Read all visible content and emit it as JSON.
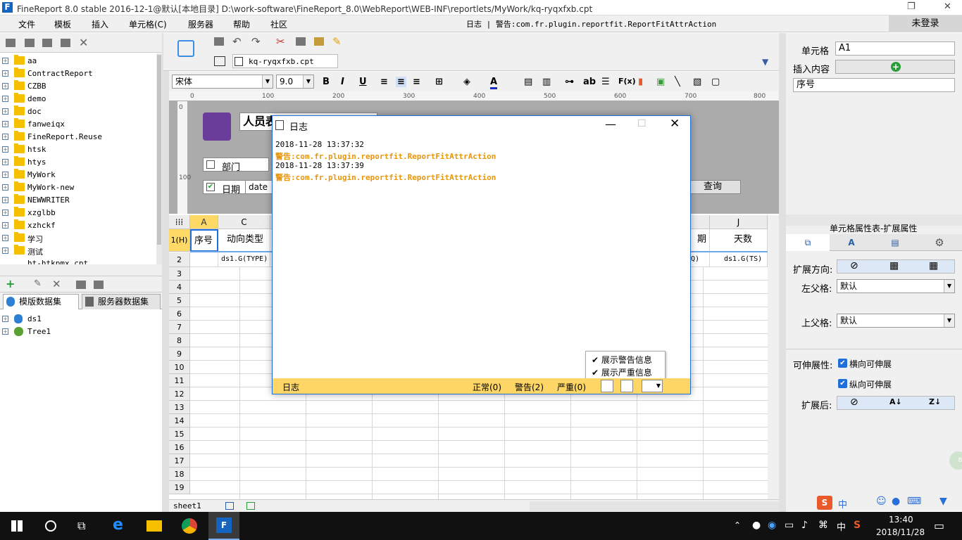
{
  "window": {
    "title": "FineReport 8.0 stable 2016-12-1@默认[本地目录]    D:\\work-software\\FineReport_8.0\\WebReport\\WEB-INF\\reportlets/MyWork/kq-ryqxfxb.cpt"
  },
  "menu": [
    "文件",
    "模板",
    "插入",
    "单元格(C)",
    "服务器",
    "帮助",
    "社区"
  ],
  "menu_status": "日志 | 警告:com.fr.plugin.reportfit.ReportFitAttrAction",
  "login": "未登录",
  "tree": [
    "aa",
    "ContractReport",
    "CZBB",
    "demo",
    "doc",
    "fanweiqx",
    "FineReport.Reuse",
    "htsk",
    "htys",
    "MyWork",
    "MyWork-new",
    "NEWWRITER",
    "xzglbb",
    "xzhckf",
    "学习",
    "测试"
  ],
  "tree_file": "ht-htkpmx.cpt",
  "ds_tabs": [
    "模版数据集",
    "服务器数据集"
  ],
  "datasets": [
    "ds1",
    "Tree1"
  ],
  "doc_tab": "kq-ryqxfxb.cpt",
  "format": {
    "font": "宋体",
    "size": "9.0"
  },
  "ruler": [
    "0",
    "100",
    "200",
    "300",
    "400",
    "500",
    "600",
    "700",
    "800"
  ],
  "vruler": [
    "0",
    "100"
  ],
  "design": {
    "title": "人员表",
    "dept_label": "部门",
    "date_label": "日期",
    "date_value": "date",
    "query_button": "查询"
  },
  "grid": {
    "cols": [
      "A",
      "C",
      "J"
    ],
    "row1": {
      "header": "1(H)",
      "a": "序号",
      "c": "动向类型",
      "i_partial": "期",
      "j": "天数"
    },
    "row2": {
      "c": "ds1.G(TYPE)",
      "i_partial": "Q)",
      "j": "ds1.G(TS)"
    },
    "rows": [
      "2",
      "3",
      "4",
      "5",
      "6",
      "7",
      "8",
      "9",
      "10",
      "11",
      "12",
      "13",
      "14",
      "15",
      "16",
      "17",
      "18",
      "19"
    ]
  },
  "sheet": "sheet1",
  "right": {
    "cell_label": "单元格",
    "cell_value": "A1",
    "insert_label": "插入内容",
    "content_value": "序号",
    "section_title": "单元格属性表-扩展属性",
    "direction_label": "扩展方向:",
    "left_parent_label": "左父格:",
    "left_parent_value": "默认",
    "up_parent_label": "上父格:",
    "up_parent_value": "默认",
    "stretch_label": "可伸展性:",
    "h_stretch": "横向可伸展",
    "v_stretch": "纵向可伸展",
    "after_label": "扩展后:"
  },
  "dialog": {
    "title": "日志",
    "logs": [
      {
        "text": "2018-11-28 13:37:32",
        "type": "time"
      },
      {
        "text": "警告:com.fr.plugin.reportfit.ReportFitAttrAction",
        "type": "warn"
      },
      {
        "text": "2018-11-28 13:37:39",
        "type": "time"
      },
      {
        "text": "警告:com.fr.plugin.reportfit.ReportFitAttrAction",
        "type": "warn"
      }
    ],
    "popup": [
      "展示警告信息",
      "展示严重信息"
    ],
    "status_label": "日志",
    "normal": "正常(0)",
    "warning": "警告(2)",
    "severe": "严重(0)"
  },
  "taskbar": {
    "time": "13:40",
    "date": "2018/11/28",
    "ime": "中",
    "badge": "80"
  },
  "colors": {
    "accent": "#1e6fd9",
    "warn": "#e8960c",
    "status_bg": "#fdd666"
  }
}
